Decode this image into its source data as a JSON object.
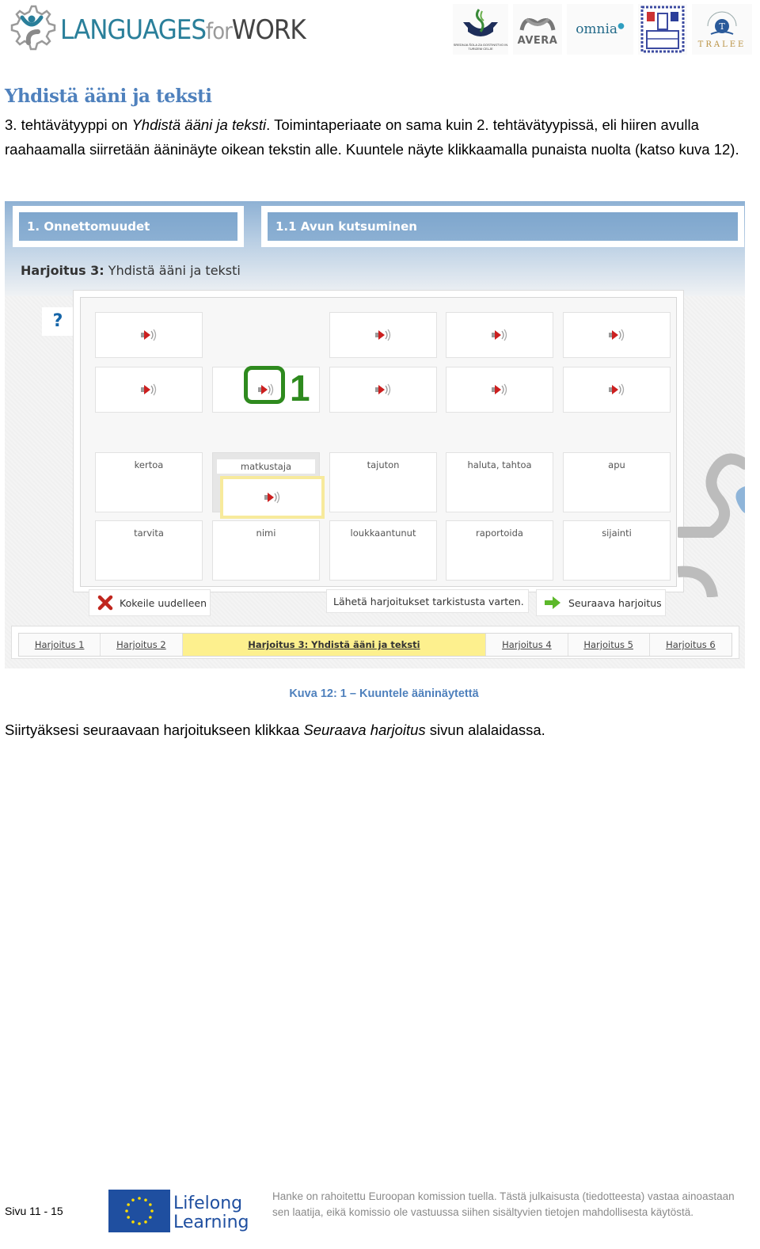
{
  "header": {
    "logo": {
      "part1": "LANGUAGES",
      "part2": "for",
      "part3": "WORK",
      "icon": "gear-person-icon"
    },
    "partners": [
      {
        "name": "school-logo",
        "caption": "SREDNJA ŠOLA ZA GOSTINSTVO IN TURIZEM CELJE"
      },
      {
        "name": "avera-logo",
        "text": "AVERA"
      },
      {
        "name": "omnia-logo",
        "text": "omnia"
      },
      {
        "name": "city-crest-logo"
      },
      {
        "name": "tralee-logo",
        "text": "TRALEE"
      }
    ]
  },
  "document": {
    "title": "Yhdistä ääni ja teksti",
    "para1": {
      "before": "3. tehtävätyyppi on ",
      "italic": "Yhdistä ääni ja teksti",
      "after": ". Toimintaperiaate on sama kuin 2. tehtävätyypissä, eli hiiren avulla raahaamalla siirretään ääninäyte oikean tekstin alle. Kuuntele näyte klikkaamalla punaista nuolta (katso kuva 12)."
    },
    "caption": "Kuva 12: 1 – Kuuntele ääninäytettä",
    "para2": {
      "before": "Siirtyäksesi seuraavaan harjoitukseen klikkaa ",
      "italic": "Seuraava harjoitus",
      "after": " sivun alalaidassa."
    }
  },
  "figure": {
    "breadcrumbs": [
      "1. Onnettomuudet",
      "1.1 Avun kutsuminen"
    ],
    "exercise_title_bold": "Harjoitus 3:",
    "exercise_title_rest": " Yhdistä ääni ja teksti",
    "help_label": "?",
    "sound_tiles_row1": [
      "sound",
      "",
      "sound",
      "sound",
      "sound"
    ],
    "sound_tiles_row2": [
      "sound",
      "sound",
      "sound",
      "sound",
      "sound"
    ],
    "highlight_number": "1",
    "word_tiles": [
      "kertoa",
      "matkustaja",
      "tajuton",
      "haluta, tahtoa",
      "apu",
      "tarvita",
      "nimi",
      "loukkaantunut",
      "raportoida",
      "sijainti"
    ],
    "selected_word": "matkustaja",
    "buttons": {
      "retry": "Kokeile uudelleen",
      "send": "Lähetä harjoitukset tarkistusta varten.",
      "next": "Seuraava harjoitus"
    },
    "tabs": [
      {
        "label": "Harjoitus 1",
        "active": false
      },
      {
        "label": "Harjoitus 2",
        "active": false
      },
      {
        "label": "Harjoitus 3: Yhdistä ääni ja teksti",
        "active": true
      },
      {
        "label": "Harjoitus 4",
        "active": false
      },
      {
        "label": "Harjoitus 5",
        "active": false
      },
      {
        "label": "Harjoitus 6",
        "active": false
      }
    ],
    "colors": {
      "highlight_green": "#2e8a1e",
      "active_tab": "#fdf08e",
      "breadcrumb_blue": "#7ea6cd",
      "speaker_red": "#cc1f1f"
    }
  },
  "footer": {
    "page": "Sivu 11 - 15",
    "program_line1": "Lifelong",
    "program_line2": "Learning",
    "disclaimer": "Hanke on rahoitettu Euroopan komission tuella. Tästä julkaisusta (tiedotteesta) vastaa ainoastaan sen laatija, eikä komissio ole vastuussa siihen sisältyvien tietojen mahdollisesta käytöstä."
  }
}
